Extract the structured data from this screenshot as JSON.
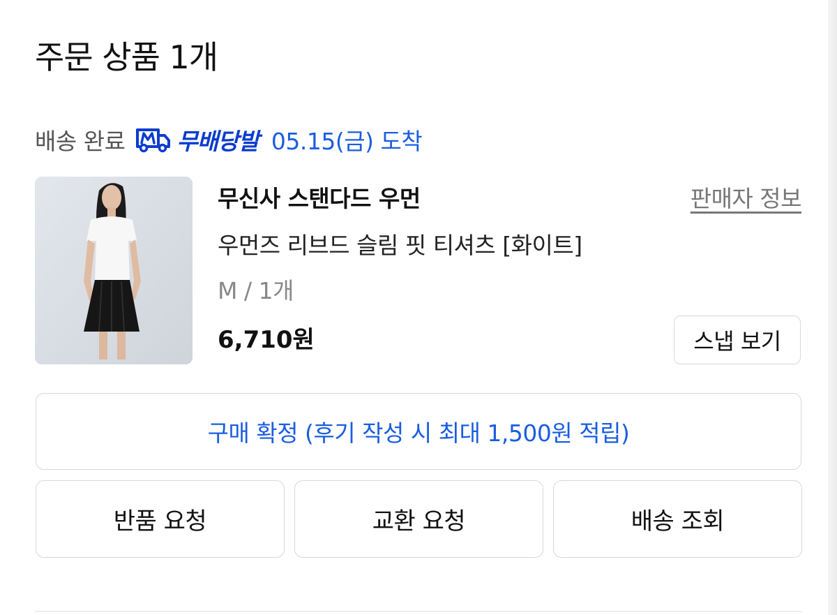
{
  "section": {
    "title": "주문 상품 1개"
  },
  "delivery": {
    "status": "배송 완료",
    "brand_icon": "truck-m-icon",
    "brand_label": "무배당발",
    "arrival": "05.15(금) 도착",
    "brand_color": "#0b3ccf",
    "accent_color": "#1a5de0"
  },
  "product": {
    "seller": "무신사 스탠다드 우먼",
    "seller_info_label": "판매자 정보",
    "name": "우먼즈 리브드 슬림 핏 티셔츠 [화이트]",
    "option": "M / 1개",
    "price": "6,710원",
    "snap_button_label": "스냅 보기"
  },
  "actions": {
    "confirm_label": "구매 확정 (후기 작성 시 최대 1,500원 적립)",
    "return_label": "반품 요청",
    "exchange_label": "교환 요청",
    "tracking_label": "배송 조회"
  }
}
